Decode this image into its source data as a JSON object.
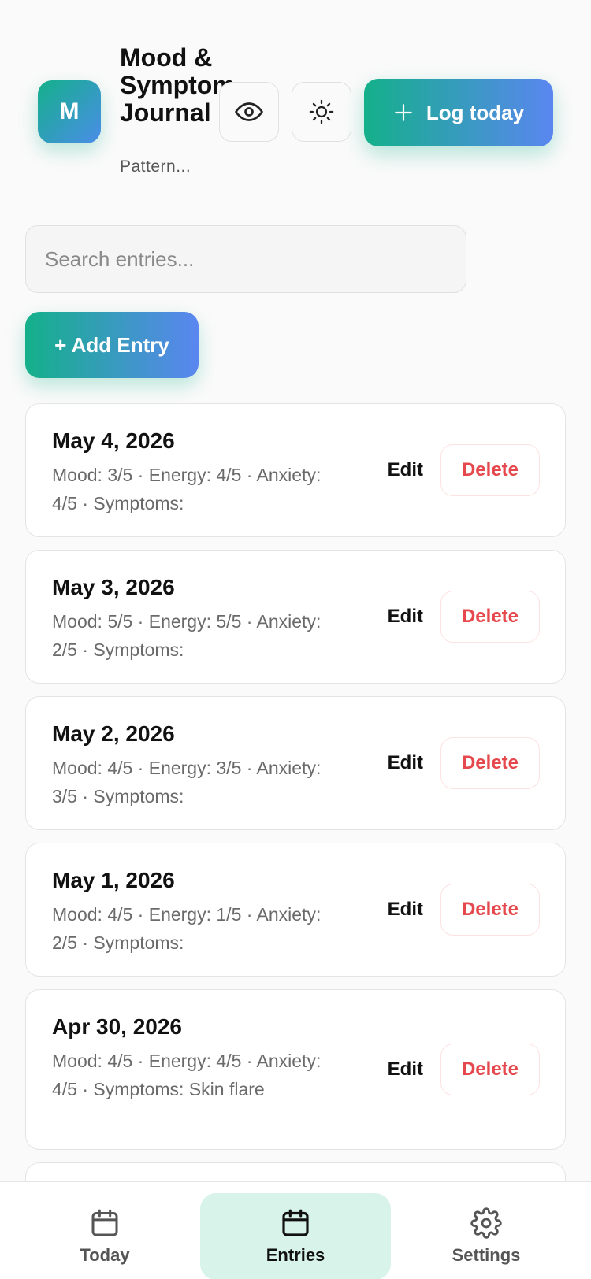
{
  "header": {
    "logo_letter": "M",
    "title": "Mood & Symptom Journal",
    "subtitle": "Pattern...",
    "log_button": "Log today"
  },
  "search": {
    "placeholder": "Search entries..."
  },
  "add_button": "+ Add Entry",
  "entries": [
    {
      "date": "May 4, 2026",
      "meta": "Mood: 3/5 · Energy: 4/5 · Anxiety: 4/5 · Symptoms:",
      "edit": "Edit",
      "delete": "Delete"
    },
    {
      "date": "May 3, 2026",
      "meta": "Mood: 5/5 · Energy: 5/5 · Anxiety: 2/5 · Symptoms:",
      "edit": "Edit",
      "delete": "Delete"
    },
    {
      "date": "May 2, 2026",
      "meta": "Mood: 4/5 · Energy: 3/5 · Anxiety: 3/5 · Symptoms:",
      "edit": "Edit",
      "delete": "Delete"
    },
    {
      "date": "May 1, 2026",
      "meta": "Mood: 4/5 · Energy: 1/5 · Anxiety: 2/5 · Symptoms:",
      "edit": "Edit",
      "delete": "Delete"
    },
    {
      "date": "Apr 30, 2026",
      "meta": "Mood: 4/5 · Energy: 4/5 · Anxiety: 4/5 · Symptoms: Skin flare",
      "edit": "Edit",
      "delete": "Delete"
    }
  ],
  "nav": [
    {
      "label": "Today",
      "icon": "calendar-icon"
    },
    {
      "label": "Entries",
      "icon": "calendar-icon",
      "active": true
    },
    {
      "label": "Settings",
      "icon": "gear-icon"
    }
  ],
  "colors": {
    "accent_start": "#14b08a",
    "accent_end": "#5a86f0",
    "danger": "#e5484d",
    "nav_active_bg": "#d8f3ea"
  }
}
